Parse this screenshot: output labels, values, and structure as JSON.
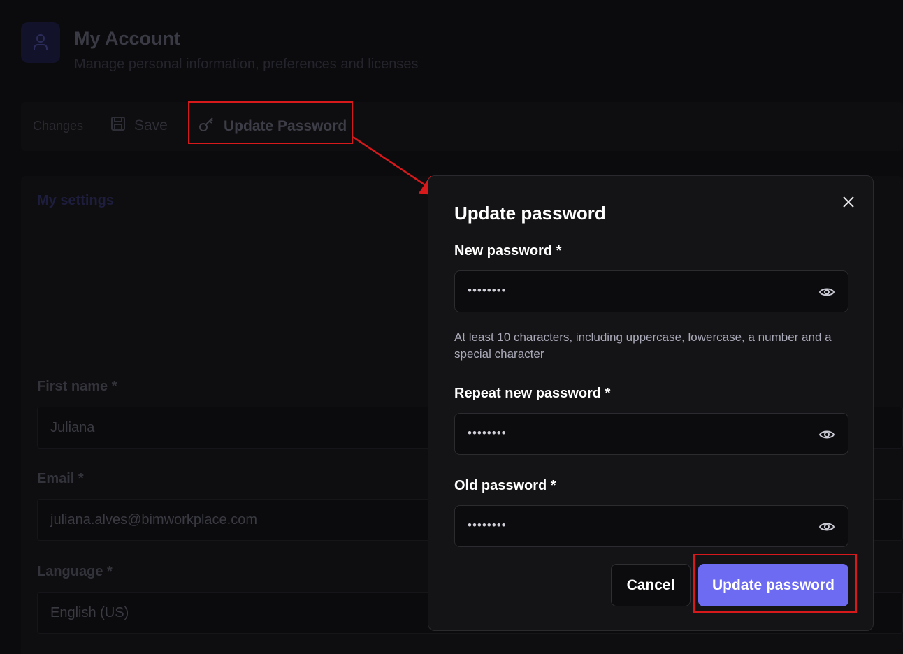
{
  "page": {
    "title": "My Account",
    "subtitle": "Manage personal information, preferences and licenses"
  },
  "toolbar": {
    "changes_label": "Changes",
    "save_label": "Save",
    "update_password_label": "Update Password"
  },
  "settings": {
    "title": "My settings",
    "fields": [
      {
        "label": "First name *",
        "value": "Juliana"
      },
      {
        "label": "Email *",
        "value": "juliana.alves@bimworkplace.com"
      },
      {
        "label": "Language *",
        "value": "English (US)"
      }
    ]
  },
  "modal": {
    "title": "Update password",
    "new_password": {
      "label": "New password *",
      "value": "••••••••"
    },
    "hint": "At least 10 characters, including uppercase, lowercase, a number and a special character",
    "repeat_password": {
      "label": "Repeat new password *",
      "value": "••••••••"
    },
    "old_password": {
      "label": "Old password *",
      "value": "••••••••"
    },
    "cancel_label": "Cancel",
    "submit_label": "Update password"
  },
  "colors": {
    "accent": "#6d6bf2",
    "annotation": "#d7191c",
    "modal_bg": "#141416"
  },
  "icons": [
    "user-icon",
    "save-icon",
    "key-icon",
    "close-icon",
    "eye-icon"
  ]
}
